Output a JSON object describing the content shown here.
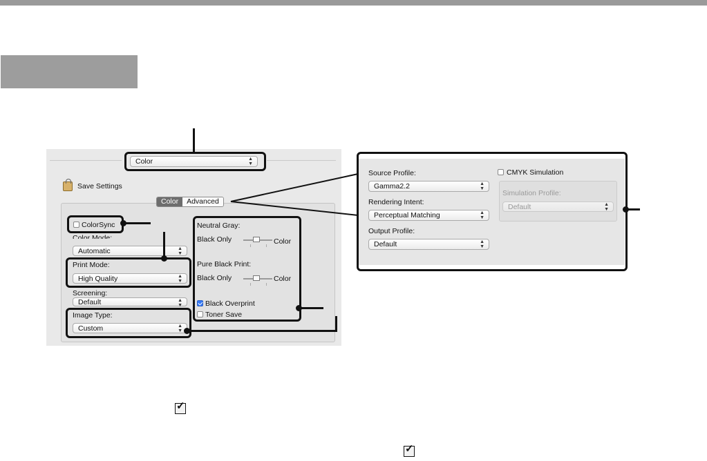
{
  "dialog": {
    "menu_select": "Color",
    "save_settings": "Save Settings",
    "tabs": [
      {
        "label": "Color",
        "active": true
      },
      {
        "label": "Advanced",
        "active": false
      }
    ],
    "colorsync_label": "ColorSync",
    "colorsync_checked": false,
    "color_mode_label": "Color Mode:",
    "color_mode_value": "Automatic",
    "print_mode_label": "Print Mode:",
    "print_mode_value": "High Quality",
    "screening_label": "Screening:",
    "screening_value": "Default",
    "image_type_label": "Image Type:",
    "image_type_value": "Custom",
    "neutral_gray_label": "Neutral Gray:",
    "neutral_gray_left": "Black Only",
    "neutral_gray_right": "Color",
    "pure_black_label": "Pure Black Print:",
    "pure_black_left": "Black Only",
    "pure_black_right": "Color",
    "black_overprint_label": "Black Overprint",
    "black_overprint_checked": true,
    "toner_save_label": "Toner Save",
    "toner_save_checked": false
  },
  "advanced": {
    "source_profile_label": "Source Profile:",
    "source_profile_value": "Gamma2.2",
    "rendering_intent_label": "Rendering Intent:",
    "rendering_intent_value": "Perceptual Matching",
    "output_profile_label": "Output Profile:",
    "output_profile_value": "Default",
    "cmyk_simulation_label": "CMYK Simulation",
    "cmyk_simulation_checked": false,
    "simulation_profile_label": "Simulation Profile:",
    "simulation_profile_value": "Default"
  },
  "icons": {
    "select_arrows": "⌃⌄",
    "checkmark": "✓"
  },
  "colors": {
    "callout": "#111111",
    "header_bar": "#9a9a9a",
    "gray_box": "#9d9d9d",
    "active_tab": "#6d6d6d"
  }
}
